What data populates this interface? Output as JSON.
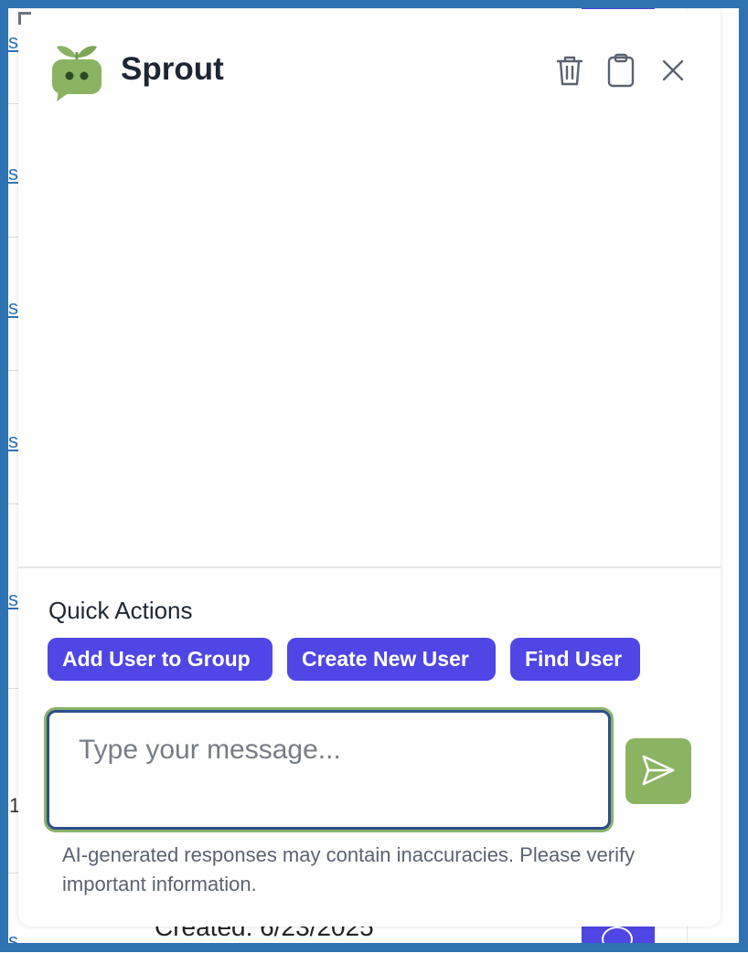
{
  "app": {
    "title": "Sprout"
  },
  "header": {
    "actions": [
      {
        "icon": "trash-icon",
        "label": "Clear chat"
      },
      {
        "icon": "clipboard-icon",
        "label": "Copy"
      },
      {
        "icon": "close-icon",
        "label": "Close"
      }
    ]
  },
  "quick_actions": {
    "title": "Quick Actions",
    "buttons": [
      "Add User to Group",
      "Create New User",
      "Find User"
    ]
  },
  "composer": {
    "placeholder": "Type your message...",
    "value": "",
    "send_icon": "send-icon"
  },
  "disclaimer": "AI-generated responses may contain inaccuracies. Please verify important information.",
  "background": {
    "link_fragments": [
      "s",
      "s",
      "s",
      "s",
      "s",
      "s",
      "s"
    ],
    "row_number": "1",
    "created_text": "Created: 6/23/2025"
  },
  "colors": {
    "accent": "#4f46e5",
    "brand_green": "#8ab462",
    "frame_blue": "#2f73b3",
    "focus_ring": "#89b268"
  }
}
